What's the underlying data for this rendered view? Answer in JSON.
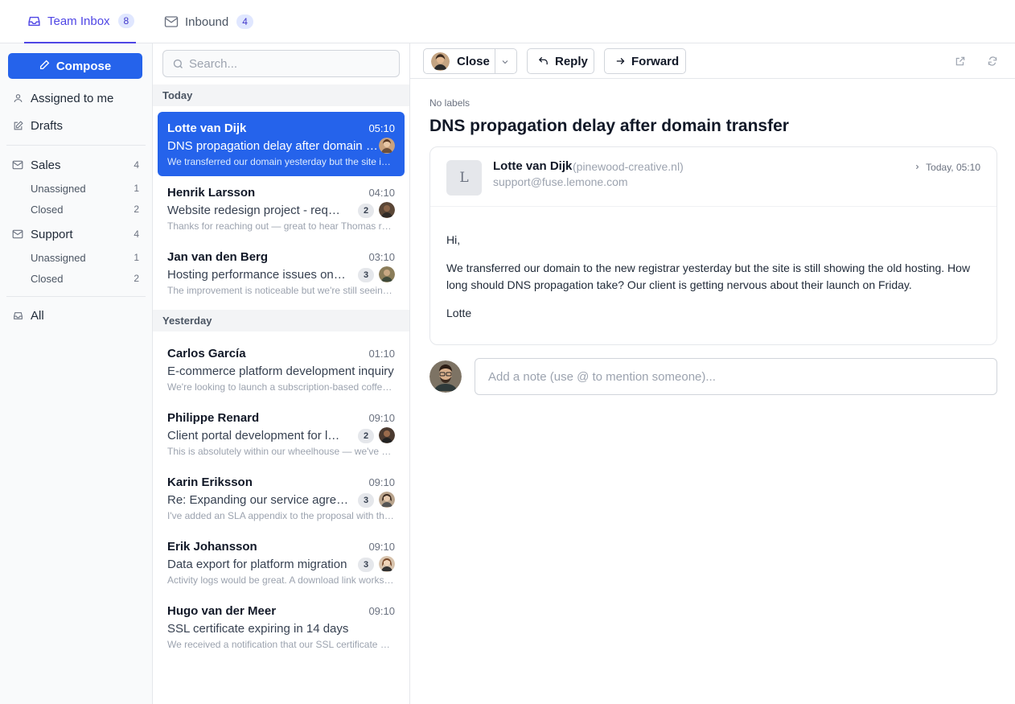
{
  "tabs": [
    {
      "label": "Team Inbox",
      "count": "8"
    },
    {
      "label": "Inbound",
      "count": "4"
    }
  ],
  "sidebar": {
    "compose_label": "Compose",
    "assigned": "Assigned to me",
    "drafts": "Drafts",
    "sales": {
      "label": "Sales",
      "count": "4",
      "unassigned": "Unassigned",
      "unassigned_count": "1",
      "closed": "Closed",
      "closed_count": "2"
    },
    "support": {
      "label": "Support",
      "count": "4",
      "unassigned": "Unassigned",
      "unassigned_count": "1",
      "closed": "Closed",
      "closed_count": "2"
    },
    "all": "All"
  },
  "list": {
    "search_placeholder": "Search...",
    "groups": [
      "Today",
      "Yesterday"
    ],
    "conversations": [
      {
        "name": "Lotte van Dijk",
        "time": "05:10",
        "subject": "DNS propagation delay after domain transfer",
        "preview": "We transferred our domain yesterday but the site is still showing the old hosting",
        "badge": ""
      },
      {
        "name": "Henrik Larsson",
        "time": "04:10",
        "subject": "Website redesign project - request for quote",
        "preview": "Thanks for reaching out — great to hear Thomas recommended us",
        "badge": "2"
      },
      {
        "name": "Jan van den Berg",
        "time": "03:10",
        "subject": "Hosting performance issues on our main site",
        "preview": "The improvement is noticeable but we're still seeing some slowness",
        "badge": "3"
      },
      {
        "name": "Carlos García",
        "time": "01:10",
        "subject": "E-commerce platform development inquiry",
        "preview": "We're looking to launch a subscription-based coffee platform",
        "badge": ""
      },
      {
        "name": "Philippe Renard",
        "time": "09:10",
        "subject": "Client portal development for law firm",
        "preview": "This is absolutely within our wheelhouse — we've built several portals",
        "badge": "2"
      },
      {
        "name": "Karin Eriksson",
        "time": "09:10",
        "subject": "Re: Expanding our service agreement",
        "preview": "I've added an SLA appendix to the proposal with the response times",
        "badge": "3"
      },
      {
        "name": "Erik Johansson",
        "time": "09:10",
        "subject": "Data export for platform migration",
        "preview": "Activity logs would be great. A download link works for us",
        "badge": "3"
      },
      {
        "name": "Hugo van der Meer",
        "time": "09:10",
        "subject": "SSL certificate expiring in 14 days",
        "preview": "We received a notification that our SSL certificate will expire soon",
        "badge": ""
      }
    ]
  },
  "toolbar": {
    "close": "Close",
    "reply": "Reply",
    "forward": "Forward"
  },
  "message": {
    "labels": "No labels",
    "subject": "DNS propagation delay after domain transfer",
    "from_name": "Lotte van Dijk",
    "from_domain": "(pinewood-creative.nl)",
    "to_address": "support@fuse.lemone.com",
    "avatar_letter": "L",
    "date": "Today, 05:10",
    "greeting": "Hi,",
    "body": "We transferred our domain to the new registrar yesterday but the site is still showing the old hosting. How long should DNS propagation take? Our client is getting nervous about their launch on Friday.",
    "signoff": "Lotte",
    "note_placeholder": "Add a note (use @ to mention someone)..."
  },
  "colors": {
    "accent": "#2563eb",
    "tab_active": "#4f46e5"
  }
}
